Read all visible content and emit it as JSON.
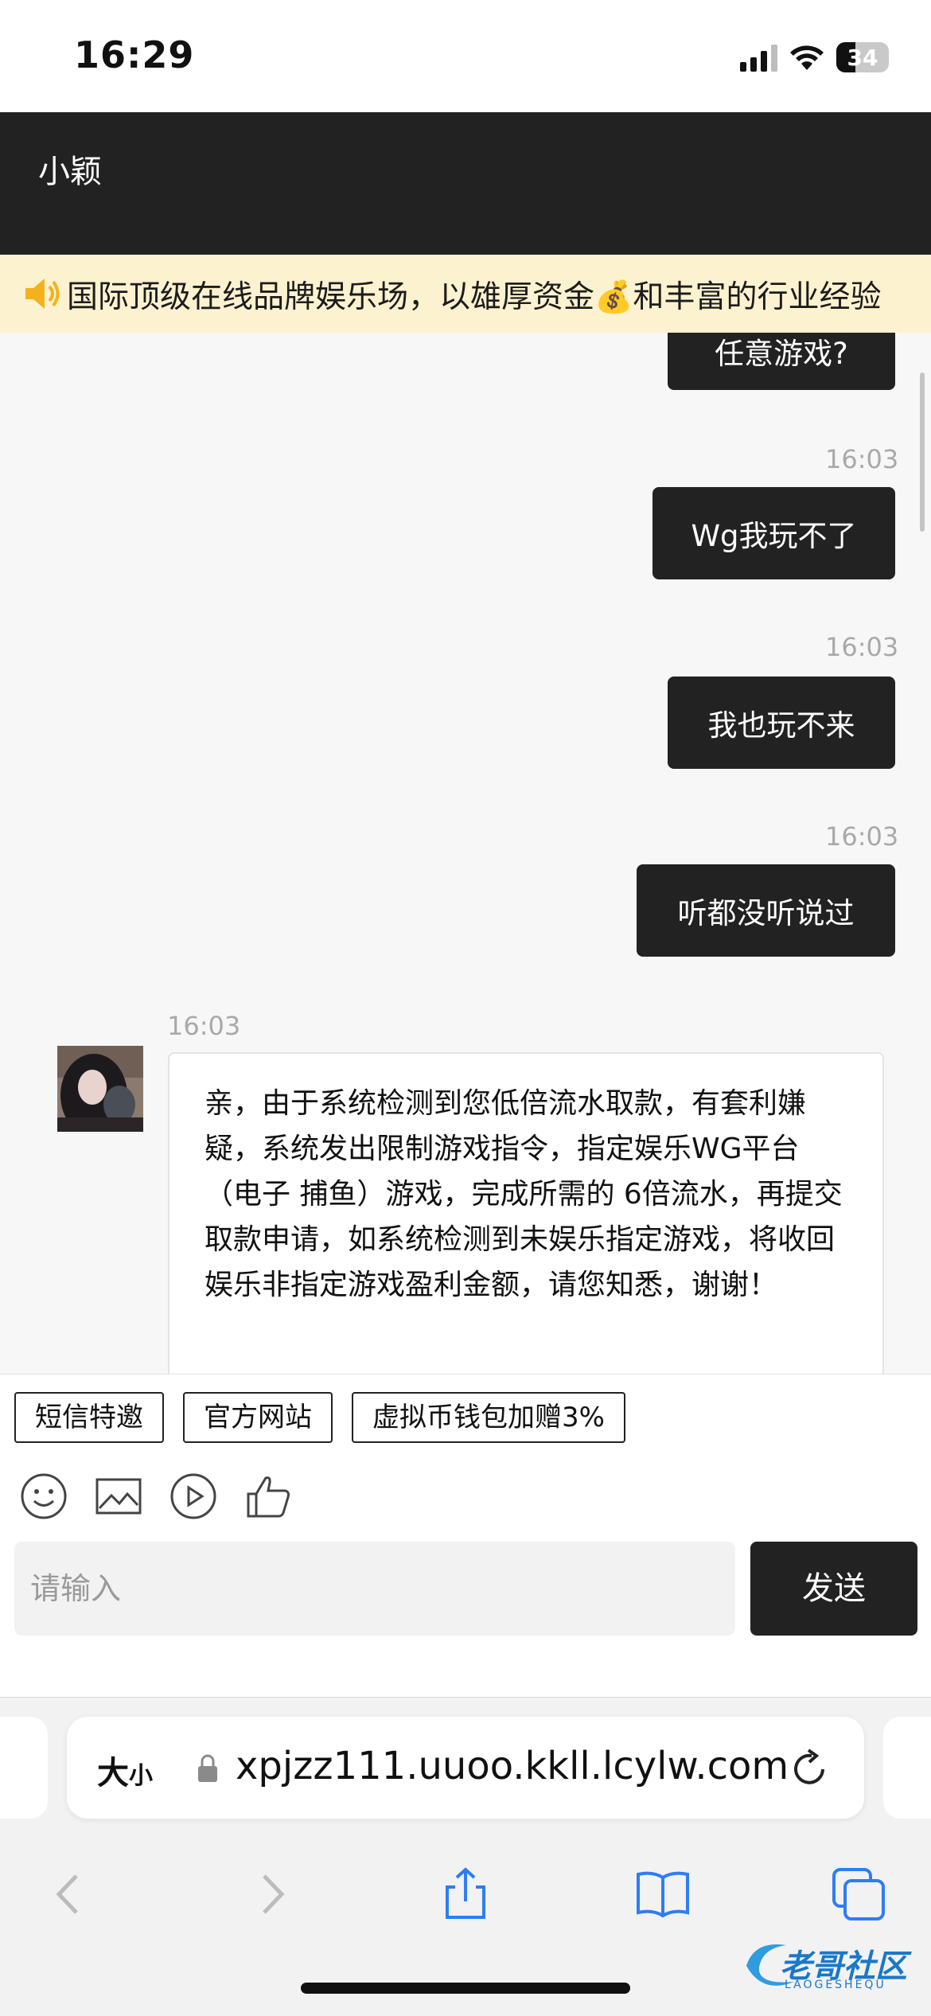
{
  "status_bar": {
    "time": "16:29",
    "battery": "34"
  },
  "chat": {
    "title": "小颖"
  },
  "notice": {
    "text": "国际顶级在线品牌娱乐场，以雄厚资金💰和丰富的行业经验"
  },
  "messages": {
    "partial": {
      "text": "任意游戏?"
    },
    "out1": {
      "time": "16:03",
      "text": "Wg我玩不了"
    },
    "out2": {
      "time": "16:03",
      "text": "我也玩不来"
    },
    "out3": {
      "time": "16:03",
      "text": "听都没听说过"
    },
    "in1": {
      "time": "16:03",
      "text": "亲，由于系统检测到您低倍流水取款，有套利嫌疑，系统发出限制游戏指令，指定娱乐WG平台（电子 捕鱼）游戏，完成所需的 6倍流水，再提交取款申请，如系统检测到未娱乐指定游戏，将收回娱乐非指定游戏盈利金额，请您知悉，谢谢！"
    }
  },
  "quick_replies": [
    "短信特邀",
    "官方网站",
    "虚拟币钱包加赠3%"
  ],
  "toolbar_icons": [
    "emoji-icon",
    "image-icon",
    "video-icon",
    "thumbs-up-icon"
  ],
  "input": {
    "placeholder": "请输入"
  },
  "send_label": "发送",
  "browser": {
    "text_size_label": "大",
    "text_size_small": "小",
    "url": "xpjzz111.uuoo.kkll.lcylw.com"
  },
  "watermark": {
    "text": "老哥社区",
    "sub": "LAOGESHEQU"
  }
}
